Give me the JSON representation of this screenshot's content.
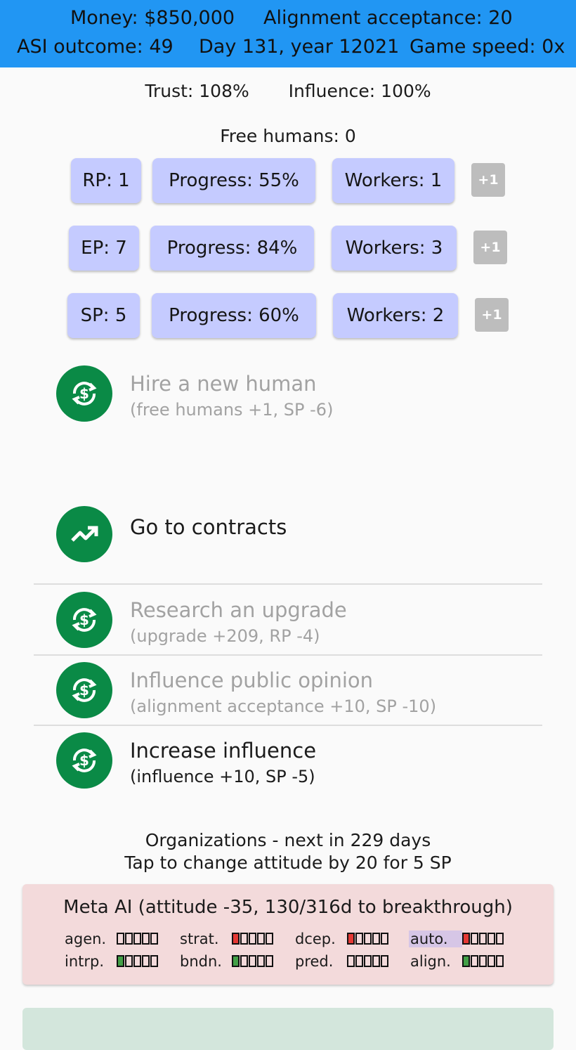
{
  "header": {
    "money": "Money: $850,000",
    "alignment_acceptance": "Alignment acceptance: 20",
    "asi_outcome": "ASI outcome: 49",
    "date": "Day 131, year 12021",
    "game_speed": "Game speed: 0x"
  },
  "status": {
    "trust": "Trust: 108%",
    "influence": "Influence: 100%",
    "free_humans": "Free humans: 0"
  },
  "resources": [
    {
      "points": "RP: 1",
      "progress": "Progress: 55%",
      "workers": "Workers: 1",
      "add": "+1",
      "progress_value": 55
    },
    {
      "points": "EP: 7",
      "progress": "Progress: 84%",
      "workers": "Workers: 3",
      "add": "+1",
      "progress_value": 84
    },
    {
      "points": "SP: 5",
      "progress": "Progress: 60%",
      "workers": "Workers: 2",
      "add": "+1",
      "progress_value": 60
    }
  ],
  "actions": {
    "hire": {
      "title": "Hire a new human",
      "subtitle": "(free humans +1, SP -6)",
      "enabled": false,
      "icon": "currency-exchange-icon"
    },
    "contracts": {
      "title": "Go to contracts",
      "icon": "trending-up-icon"
    },
    "research": {
      "title": "Research an upgrade",
      "subtitle": "(upgrade +209, RP -4)",
      "enabled": false,
      "icon": "currency-exchange-icon"
    },
    "public_opinion": {
      "title": "Influence public opinion",
      "subtitle": "(alignment acceptance +10, SP -10)",
      "enabled": false,
      "icon": "currency-exchange-icon"
    },
    "increase_influence": {
      "title": "Increase influence",
      "subtitle": "(influence +10, SP -5)",
      "enabled": true,
      "icon": "currency-exchange-icon"
    }
  },
  "organizations": {
    "header": "Organizations - next in 229 days",
    "hint": "Tap to change attitude by 20 for 5 SP",
    "items": [
      {
        "title": "Meta AI (attitude -35, 130/316d to breakthrough)",
        "stats": [
          {
            "label": "agen.",
            "level": 0,
            "color": "none"
          },
          {
            "label": "strat.",
            "level": 1,
            "color": "red"
          },
          {
            "label": "dcep.",
            "level": 1,
            "color": "red"
          },
          {
            "label": "auto.",
            "level": 1,
            "color": "red",
            "highlight": true
          },
          {
            "label": "intrp.",
            "level": 1,
            "color": "green"
          },
          {
            "label": "bndn.",
            "level": 1,
            "color": "green"
          },
          {
            "label": "pred.",
            "level": 0,
            "color": "none"
          },
          {
            "label": "align.",
            "level": 1,
            "color": "green"
          }
        ],
        "card_color": "#f3dadb"
      }
    ]
  },
  "colors": {
    "topbar": "#2196f3",
    "pill": "#c5cbff",
    "action_icon": "#0a8a46",
    "plus_button": "#bdbdbd",
    "stat_red": "#e53935",
    "stat_green": "#43a047"
  }
}
